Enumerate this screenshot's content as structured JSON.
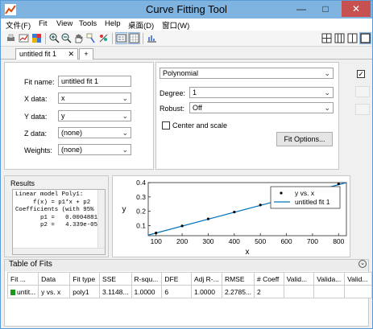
{
  "window": {
    "title": "Curve Fitting Tool",
    "controls": [
      "—",
      "□",
      "✕"
    ]
  },
  "menu": [
    "文件(F)",
    "Fit",
    "View",
    "Tools",
    "Help",
    "桌面(D)",
    "窗口(W)"
  ],
  "tabs": {
    "active": "untitled fit 1",
    "close": "✕",
    "add": "+"
  },
  "fit_panel": {
    "fit_name_label": "Fit name:",
    "fit_name_value": "untitled fit 1",
    "x_label": "X data:",
    "x_value": "x",
    "y_label": "Y data:",
    "y_value": "y",
    "z_label": "Z data:",
    "z_value": "(none)",
    "w_label": "Weights:",
    "w_value": "(none)"
  },
  "type_panel": {
    "fit_type": "Polynomial",
    "degree_label": "Degree:",
    "degree_value": "1",
    "robust_label": "Robust:",
    "robust_value": "Off",
    "center_label": "Center and scale",
    "options_button": "Fit Options..."
  },
  "results": {
    "title": "Results",
    "lines": [
      "Linear model Poly1:",
      "     f(x) = p1*x + p2",
      "Coefficients (with 95% c",
      "       p1 =   0.0004881",
      "       p2 =   4.339e-05"
    ]
  },
  "chart_data": {
    "type": "line",
    "xlabel": "x",
    "ylabel": "y",
    "xlim": [
      70,
      830
    ],
    "ylim": [
      0.03,
      0.4
    ],
    "xticks": [
      "100",
      "200",
      "300",
      "400",
      "500",
      "600",
      "700",
      "800"
    ],
    "yticks": [
      "0.1",
      "0.2",
      "0.3",
      "0.4"
    ],
    "legend": [
      "y vs. x",
      "untitled fit 1"
    ],
    "legend_position": "right",
    "points": [
      {
        "x": 100,
        "y": 0.049
      },
      {
        "x": 200,
        "y": 0.098
      },
      {
        "x": 300,
        "y": 0.147
      },
      {
        "x": 400,
        "y": 0.195
      },
      {
        "x": 500,
        "y": 0.244
      },
      {
        "x": 600,
        "y": 0.293
      },
      {
        "x": 700,
        "y": 0.342
      },
      {
        "x": 800,
        "y": 0.391
      }
    ],
    "fit": {
      "p1": 0.0004881,
      "p2": 4.339e-05
    },
    "series_colors": {
      "points": "#000000",
      "fit": "#0072bd"
    }
  },
  "table": {
    "title": "Table of Fits",
    "headers": [
      "Fit ...",
      "Data",
      "Fit type",
      "SSE",
      "R-squ...",
      "DFE",
      "Adj R-...",
      "RMSE",
      "# Coeff",
      "Valid...",
      "Valida...",
      "Valid..."
    ],
    "rows": [
      [
        "untit...",
        "y vs. x",
        "poly1",
        "3.1148...",
        "1.0000",
        "6",
        "1.0000",
        "2.2785...",
        "2",
        "",
        "",
        ""
      ]
    ]
  },
  "colors": {
    "titlebar": "#7fb4e0",
    "fit_line": "#0072bd",
    "close": "#c75050",
    "row_icon": "#1a9a1a"
  }
}
